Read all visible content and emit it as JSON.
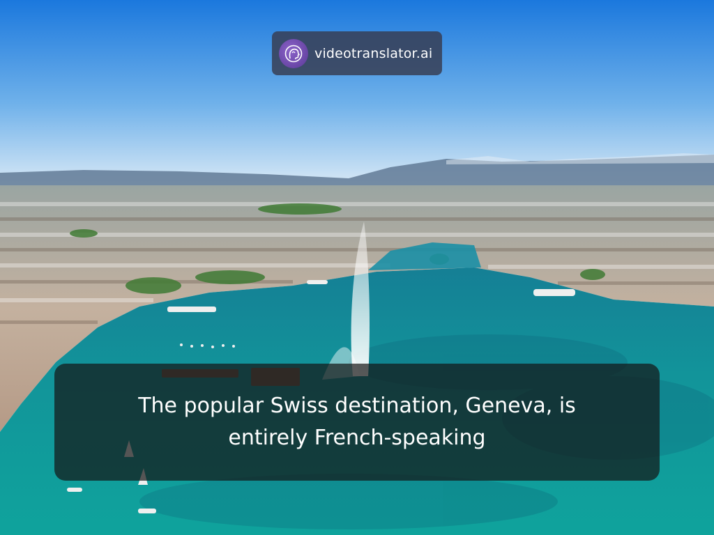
{
  "brand": {
    "name": "videotranslator.ai",
    "logo_icon": "head-profile-icon",
    "pill_color": "#373a4e",
    "logo_color": "#6e48ad"
  },
  "caption": {
    "text": "The popular Swiss destination, Geneva, is entirely French-speaking"
  },
  "scene": {
    "colors": {
      "sky_top": "#1f7fe0",
      "sky_horizon": "#d7e9f7",
      "mountains": "#5d7390",
      "city": "#b8a595",
      "lake": "#119a9a",
      "lake_deep": "#0f6f86"
    }
  }
}
